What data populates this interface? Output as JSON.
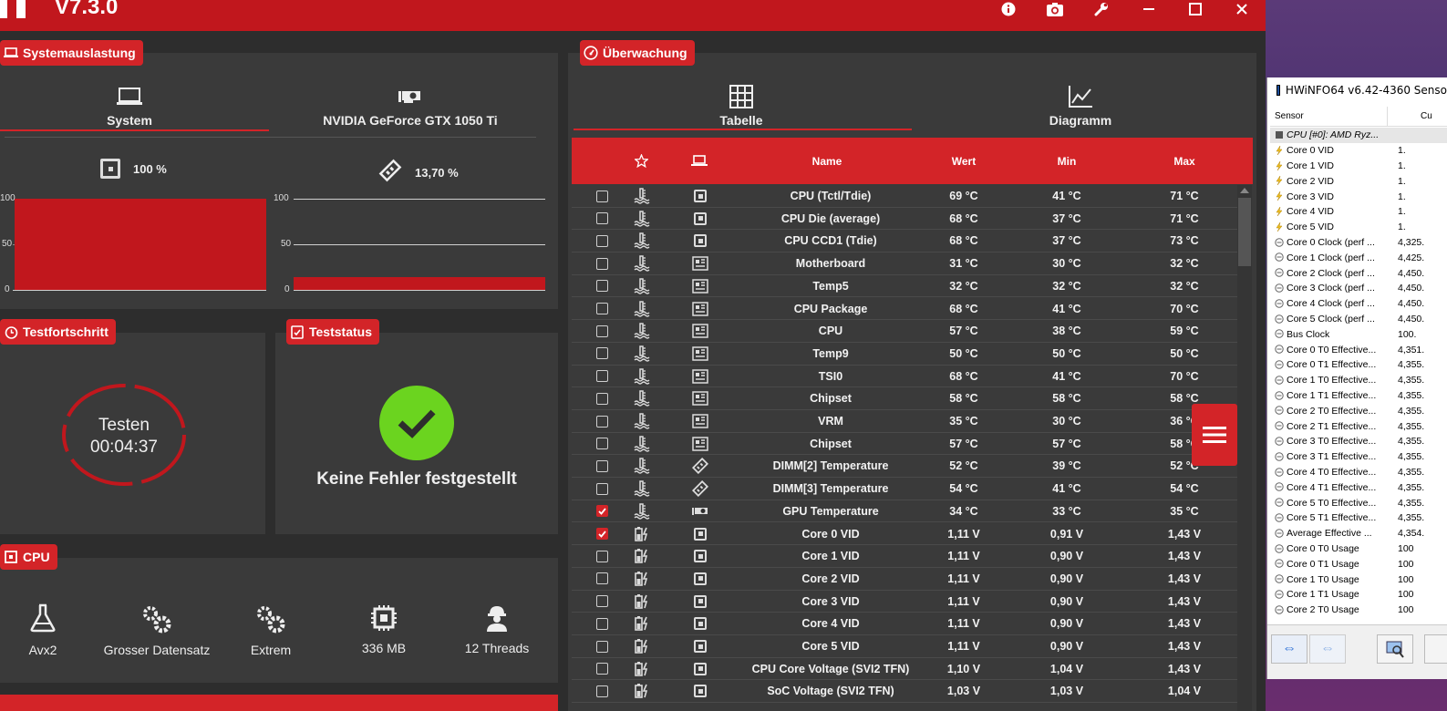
{
  "app": {
    "version": "V7.3.0",
    "titlebar_buttons": [
      "info-icon",
      "camera-icon",
      "wrench-icon",
      "minimize-icon",
      "maximize-icon",
      "close-icon"
    ]
  },
  "system_load": {
    "badge": "Systemauslastung",
    "tabs": [
      {
        "label": "System",
        "icon": "laptop-icon",
        "active": true
      },
      {
        "label": "NVIDIA GeForce GTX 1050 Ti",
        "icon": "gpu-icon",
        "active": false
      }
    ],
    "cpu_value": "100 %",
    "mem_value": "13,70 %"
  },
  "chart_data": [
    {
      "type": "area",
      "ylim": [
        0,
        100
      ],
      "yticks": [
        "100",
        "50",
        "0"
      ],
      "series": [
        {
          "values": [
            100,
            100
          ]
        }
      ]
    },
    {
      "type": "area",
      "ylim": [
        0,
        100
      ],
      "yticks": [
        "100",
        "50",
        "0"
      ],
      "series": [
        {
          "values": [
            13.7,
            13.7
          ]
        }
      ]
    }
  ],
  "progress": {
    "badge": "Testfortschritt",
    "status": "Testen",
    "time": "00:04:37"
  },
  "test_status": {
    "badge": "Teststatus",
    "message": "Keine Fehler festgestellt"
  },
  "cpu": {
    "badge": "CPU",
    "items": [
      {
        "label": "Avx2",
        "icon": "flask-icon"
      },
      {
        "label": "Grosser Datensatz",
        "icon": "gears-icon"
      },
      {
        "label": "Extrem",
        "icon": "gears-icon"
      },
      {
        "label": "336 MB",
        "icon": "chip-icon"
      },
      {
        "label": "12 Threads",
        "icon": "worker-icon"
      }
    ]
  },
  "monitoring": {
    "badge": "Überwachung",
    "tabs": [
      {
        "label": "Tabelle",
        "icon": "grid-icon",
        "active": true
      },
      {
        "label": "Diagramm",
        "icon": "line-chart-icon",
        "active": false
      }
    ],
    "columns": {
      "name": "Name",
      "value": "Wert",
      "min": "Min",
      "max": "Max"
    },
    "rows": [
      {
        "checked": false,
        "type": "temp",
        "src": "cpu",
        "name": "CPU (Tctl/Tdie)",
        "value": "69 °C",
        "min": "41 °C",
        "max": "71 °C"
      },
      {
        "checked": false,
        "type": "temp",
        "src": "cpu",
        "name": "CPU Die (average)",
        "value": "68 °C",
        "min": "37 °C",
        "max": "71 °C"
      },
      {
        "checked": false,
        "type": "temp",
        "src": "cpu",
        "name": "CPU CCD1 (Tdie)",
        "value": "68 °C",
        "min": "37 °C",
        "max": "73 °C"
      },
      {
        "checked": false,
        "type": "temp",
        "src": "board",
        "name": "Motherboard",
        "value": "31 °C",
        "min": "30 °C",
        "max": "32 °C"
      },
      {
        "checked": false,
        "type": "temp",
        "src": "board",
        "name": "Temp5",
        "value": "32 °C",
        "min": "32 °C",
        "max": "32 °C"
      },
      {
        "checked": false,
        "type": "temp",
        "src": "board",
        "name": "CPU Package",
        "value": "68 °C",
        "min": "41 °C",
        "max": "70 °C"
      },
      {
        "checked": false,
        "type": "temp",
        "src": "board",
        "name": "CPU",
        "value": "57 °C",
        "min": "38 °C",
        "max": "59 °C"
      },
      {
        "checked": false,
        "type": "temp",
        "src": "board",
        "name": "Temp9",
        "value": "50 °C",
        "min": "50 °C",
        "max": "50 °C"
      },
      {
        "checked": false,
        "type": "temp",
        "src": "board",
        "name": "TSI0",
        "value": "68 °C",
        "min": "41 °C",
        "max": "70 °C"
      },
      {
        "checked": false,
        "type": "temp",
        "src": "board",
        "name": "Chipset",
        "value": "58 °C",
        "min": "58 °C",
        "max": "58 °C"
      },
      {
        "checked": false,
        "type": "temp",
        "src": "board",
        "name": "VRM",
        "value": "35 °C",
        "min": "30 °C",
        "max": "36 °C"
      },
      {
        "checked": false,
        "type": "temp",
        "src": "board",
        "name": "Chipset",
        "value": "57 °C",
        "min": "57 °C",
        "max": "58 °C"
      },
      {
        "checked": false,
        "type": "temp",
        "src": "ram",
        "name": "DIMM[2] Temperature",
        "value": "52 °C",
        "min": "39 °C",
        "max": "52 °C"
      },
      {
        "checked": false,
        "type": "temp",
        "src": "ram",
        "name": "DIMM[3] Temperature",
        "value": "54 °C",
        "min": "41 °C",
        "max": "54 °C"
      },
      {
        "checked": true,
        "type": "temp",
        "src": "gpu",
        "name": "GPU Temperature",
        "value": "34 °C",
        "min": "33 °C",
        "max": "35 °C"
      },
      {
        "checked": true,
        "type": "volt",
        "src": "cpu",
        "name": "Core 0 VID",
        "value": "1,11 V",
        "min": "0,91 V",
        "max": "1,43 V"
      },
      {
        "checked": false,
        "type": "volt",
        "src": "cpu",
        "name": "Core 1 VID",
        "value": "1,11 V",
        "min": "0,90 V",
        "max": "1,43 V"
      },
      {
        "checked": false,
        "type": "volt",
        "src": "cpu",
        "name": "Core 2 VID",
        "value": "1,11 V",
        "min": "0,90 V",
        "max": "1,43 V"
      },
      {
        "checked": false,
        "type": "volt",
        "src": "cpu",
        "name": "Core 3 VID",
        "value": "1,11 V",
        "min": "0,90 V",
        "max": "1,43 V"
      },
      {
        "checked": false,
        "type": "volt",
        "src": "cpu",
        "name": "Core 4 VID",
        "value": "1,11 V",
        "min": "0,90 V",
        "max": "1,43 V"
      },
      {
        "checked": false,
        "type": "volt",
        "src": "cpu",
        "name": "Core 5 VID",
        "value": "1,11 V",
        "min": "0,90 V",
        "max": "1,43 V"
      },
      {
        "checked": false,
        "type": "volt",
        "src": "cpu",
        "name": "CPU Core Voltage (SVI2 TFN)",
        "value": "1,10 V",
        "min": "1,04 V",
        "max": "1,43 V"
      },
      {
        "checked": false,
        "type": "volt",
        "src": "cpu",
        "name": "SoC Voltage (SVI2 TFN)",
        "value": "1,03 V",
        "min": "1,03 V",
        "max": "1,04 V"
      }
    ]
  },
  "hwinfo": {
    "title": "HWiNFO64 v6.42-4360 Senso",
    "col_sensor": "Sensor",
    "col_current": "Cu",
    "rows": [
      {
        "icon": "chip",
        "name": "CPU [#0]: AMD Ryz...",
        "value": "",
        "group": true
      },
      {
        "icon": "bolt",
        "name": "Core 0 VID",
        "value": "1."
      },
      {
        "icon": "bolt",
        "name": "Core 1 VID",
        "value": "1."
      },
      {
        "icon": "bolt",
        "name": "Core 2 VID",
        "value": "1."
      },
      {
        "icon": "bolt",
        "name": "Core 3 VID",
        "value": "1."
      },
      {
        "icon": "bolt",
        "name": "Core 4 VID",
        "value": "1."
      },
      {
        "icon": "bolt",
        "name": "Core 5 VID",
        "value": "1."
      },
      {
        "icon": "clock",
        "name": "Core 0 Clock (perf ...",
        "value": "4,325."
      },
      {
        "icon": "clock",
        "name": "Core 1 Clock (perf ...",
        "value": "4,425."
      },
      {
        "icon": "clock",
        "name": "Core 2 Clock (perf ...",
        "value": "4,450."
      },
      {
        "icon": "clock",
        "name": "Core 3 Clock (perf ...",
        "value": "4,450."
      },
      {
        "icon": "clock",
        "name": "Core 4 Clock (perf ...",
        "value": "4,450."
      },
      {
        "icon": "clock",
        "name": "Core 5 Clock (perf ...",
        "value": "4,450."
      },
      {
        "icon": "clock",
        "name": "Bus Clock",
        "value": "100."
      },
      {
        "icon": "clock",
        "name": "Core 0 T0 Effective...",
        "value": "4,351."
      },
      {
        "icon": "clock",
        "name": "Core 0 T1 Effective...",
        "value": "4,355."
      },
      {
        "icon": "clock",
        "name": "Core 1 T0 Effective...",
        "value": "4,355."
      },
      {
        "icon": "clock",
        "name": "Core 1 T1 Effective...",
        "value": "4,355."
      },
      {
        "icon": "clock",
        "name": "Core 2 T0 Effective...",
        "value": "4,355."
      },
      {
        "icon": "clock",
        "name": "Core 2 T1 Effective...",
        "value": "4,355."
      },
      {
        "icon": "clock",
        "name": "Core 3 T0 Effective...",
        "value": "4,355."
      },
      {
        "icon": "clock",
        "name": "Core 3 T1 Effective...",
        "value": "4,355."
      },
      {
        "icon": "clock",
        "name": "Core 4 T0 Effective...",
        "value": "4,355."
      },
      {
        "icon": "clock",
        "name": "Core 4 T1 Effective...",
        "value": "4,355."
      },
      {
        "icon": "clock",
        "name": "Core 5 T0 Effective...",
        "value": "4,355."
      },
      {
        "icon": "clock",
        "name": "Core 5 T1 Effective...",
        "value": "4,355."
      },
      {
        "icon": "clock",
        "name": "Average Effective ...",
        "value": "4,354."
      },
      {
        "icon": "clock",
        "name": "Core 0 T0 Usage",
        "value": "100"
      },
      {
        "icon": "clock",
        "name": "Core 0 T1 Usage",
        "value": "100"
      },
      {
        "icon": "clock",
        "name": "Core 1 T0 Usage",
        "value": "100"
      },
      {
        "icon": "clock",
        "name": "Core 1 T1 Usage",
        "value": "100"
      },
      {
        "icon": "clock",
        "name": "Core 2 T0 Usage",
        "value": "100"
      }
    ]
  }
}
